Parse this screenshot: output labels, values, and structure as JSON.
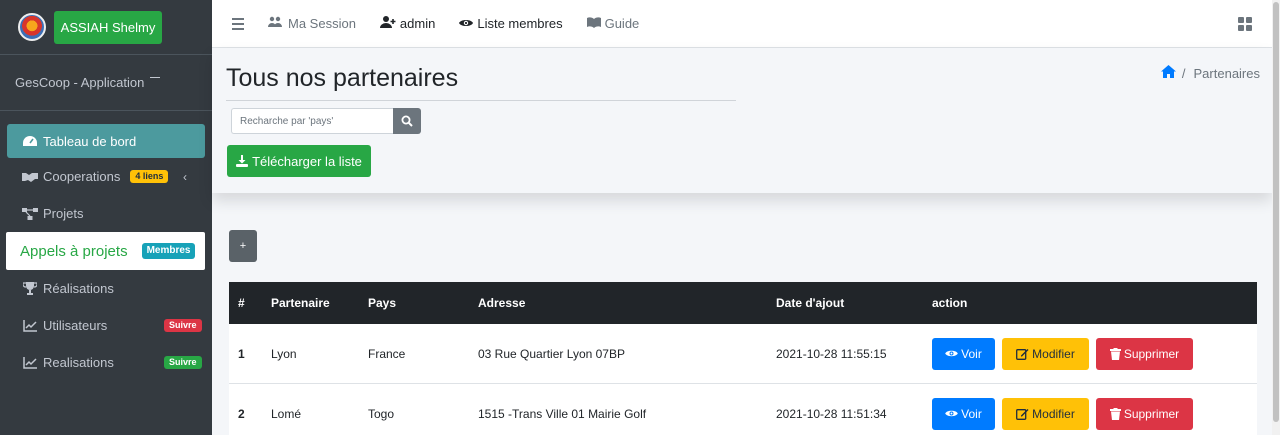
{
  "sidebar": {
    "brand_button": "ASSIAH Shelmy",
    "app_name": "GesCoop - Application",
    "items": [
      {
        "label": "Tableau de bord"
      },
      {
        "label": "Cooperations",
        "badge": "4 liens"
      },
      {
        "label": "Projets"
      },
      {
        "label": "Appels à projets",
        "badge": "Membres"
      },
      {
        "label": "Réalisations"
      },
      {
        "label": "Utilisateurs",
        "badge": "Suivre"
      },
      {
        "label": "Realisations",
        "badge": "Suivre"
      }
    ]
  },
  "topbar": {
    "links": [
      {
        "label": "Ma Session"
      },
      {
        "label": "admin"
      },
      {
        "label": "Liste membres"
      },
      {
        "label": "Guide"
      }
    ]
  },
  "header": {
    "title": "Tous nos partenaires",
    "breadcrumb": "Partenaires",
    "search_placeholder": "Recharche par 'pays'",
    "download_label": "Télécharger la liste",
    "add_label": "+"
  },
  "table": {
    "columns": [
      "#",
      "Partenaire",
      "Pays",
      "Adresse",
      "Date d'ajout",
      "action"
    ],
    "rows": [
      {
        "num": "1",
        "partenaire": "Lyon",
        "pays": "France",
        "adresse": "03 Rue Quartier Lyon 07BP",
        "date": "2021-10-28 11:55:15"
      },
      {
        "num": "2",
        "partenaire": "Lomé",
        "pays": "Togo",
        "adresse": "1515 -Trans Ville 01 Mairie Golf",
        "date": "2021-10-28 11:51:34"
      }
    ],
    "actions": {
      "view": "Voir",
      "edit": "Modifier",
      "delete": "Supprimer"
    }
  }
}
